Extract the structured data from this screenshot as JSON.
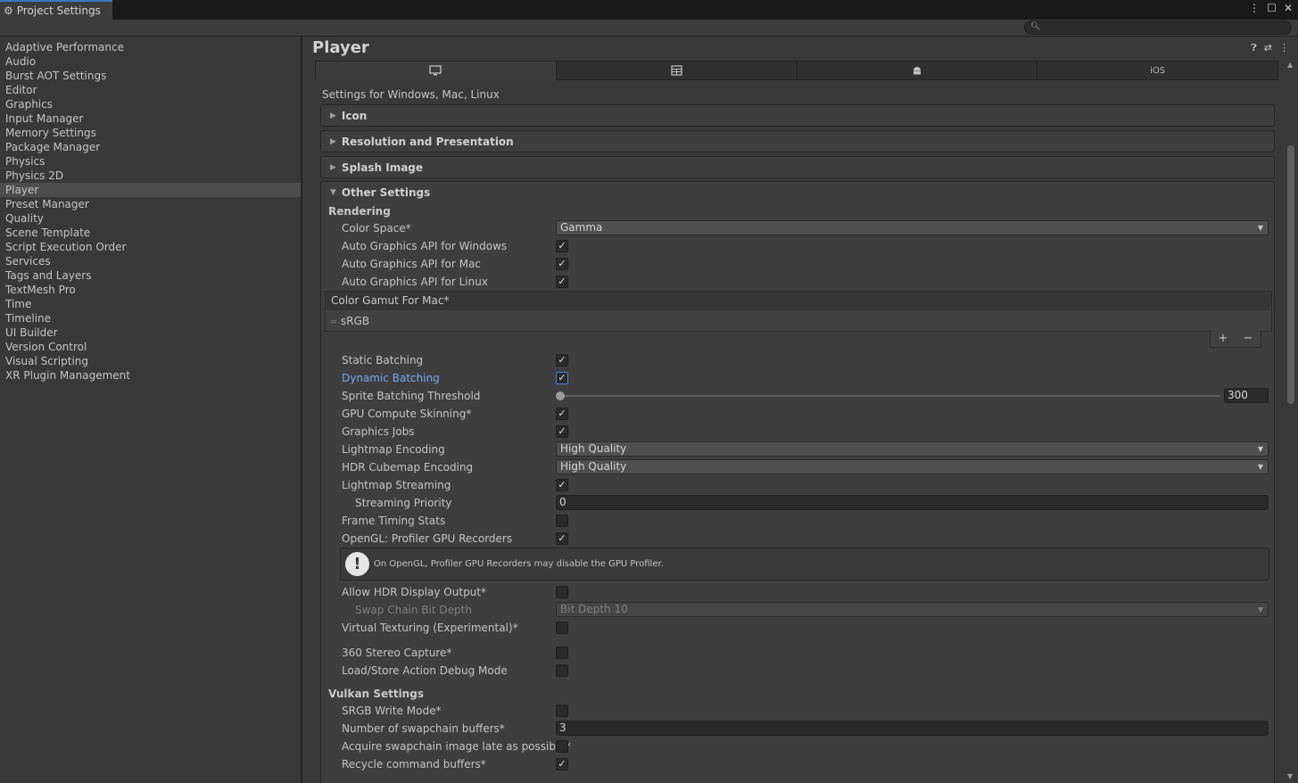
{
  "window": {
    "tab_title": "Project Settings",
    "controls": [
      "⋮",
      "☐",
      "✕"
    ]
  },
  "search": {
    "placeholder": ""
  },
  "sidebar": {
    "items": [
      {
        "label": "Adaptive Performance"
      },
      {
        "label": "Audio"
      },
      {
        "label": "Burst AOT Settings"
      },
      {
        "label": "Editor"
      },
      {
        "label": "Graphics"
      },
      {
        "label": "Input Manager"
      },
      {
        "label": "Memory Settings"
      },
      {
        "label": "Package Manager"
      },
      {
        "label": "Physics"
      },
      {
        "label": "Physics 2D"
      },
      {
        "label": "Player",
        "active": true
      },
      {
        "label": "Preset Manager"
      },
      {
        "label": "Quality"
      },
      {
        "label": "Scene Template"
      },
      {
        "label": "Script Execution Order"
      },
      {
        "label": "Services"
      },
      {
        "label": "Tags and Layers"
      },
      {
        "label": "TextMesh Pro"
      },
      {
        "label": "Time"
      },
      {
        "label": "Timeline"
      },
      {
        "label": "UI Builder"
      },
      {
        "label": "Version Control"
      },
      {
        "label": "Visual Scripting"
      },
      {
        "label": "XR Plugin Management"
      }
    ]
  },
  "main": {
    "title": "Player",
    "platform_tabs": [
      {
        "icon": "monitor-icon",
        "label": "",
        "active": true
      },
      {
        "icon": "webgl-icon",
        "label": ""
      },
      {
        "icon": "android-icon",
        "label": ""
      },
      {
        "icon": "",
        "label": "iOS"
      }
    ],
    "settings_for": "Settings for Windows, Mac, Linux",
    "foldouts": {
      "icon": "Icon",
      "resolution": "Resolution and Presentation",
      "splash": "Splash Image",
      "other": "Other Settings"
    },
    "rendering": {
      "heading": "Rendering",
      "color_space_label": "Color Space*",
      "color_space_value": "Gamma",
      "auto_win_label": "Auto Graphics API  for Windows",
      "auto_mac_label": "Auto Graphics API  for Mac",
      "auto_linux_label": "Auto Graphics API  for Linux",
      "gamut_header": "Color Gamut For Mac*",
      "gamut_item": "sRGB",
      "gamut_add": "+",
      "gamut_remove": "−",
      "static_batching_label": "Static Batching",
      "dynamic_batching_label": "Dynamic Batching",
      "sprite_threshold_label": "Sprite Batching Threshold",
      "sprite_threshold_value": "300",
      "gpu_skinning_label": "GPU Compute Skinning*",
      "graphics_jobs_label": "Graphics Jobs",
      "lightmap_encoding_label": "Lightmap Encoding",
      "lightmap_encoding_value": "High Quality",
      "hdr_cubemap_label": "HDR Cubemap Encoding",
      "hdr_cubemap_value": "High Quality",
      "lightmap_streaming_label": "Lightmap Streaming",
      "streaming_priority_label": "Streaming Priority",
      "streaming_priority_value": "0",
      "frame_timing_label": "Frame Timing Stats",
      "opengl_profiler_label": "OpenGL: Profiler GPU Recorders",
      "help_text": "On OpenGL, Profiler GPU Recorders may disable the GPU Profiler.",
      "allow_hdr_label": "Allow HDR Display Output*",
      "swap_chain_label": "Swap Chain Bit Depth",
      "swap_chain_value": "Bit Depth 10",
      "virtual_texturing_label": "Virtual Texturing (Experimental)*",
      "stereo_label": "360 Stereo Capture*",
      "load_store_label": "Load/Store Action Debug Mode"
    },
    "vulkan": {
      "heading": "Vulkan Settings",
      "srgb_label": "SRGB Write Mode*",
      "swapchain_buffers_label": "Number of swapchain buffers*",
      "swapchain_buffers_value": "3",
      "acquire_label": "Acquire swapchain image late as possible*",
      "recycle_label": "Recycle command buffers*"
    },
    "checks": {
      "auto_win": true,
      "auto_mac": true,
      "auto_linux": true,
      "static_batching": true,
      "dynamic_batching": true,
      "gpu_skinning": true,
      "graphics_jobs": true,
      "lightmap_streaming": true,
      "frame_timing": false,
      "opengl_profiler": true,
      "allow_hdr": false,
      "virtual_texturing": false,
      "stereo": false,
      "load_store": false,
      "srgb": false,
      "acquire": false,
      "recycle": true
    },
    "slider_fraction": 0.0
  }
}
